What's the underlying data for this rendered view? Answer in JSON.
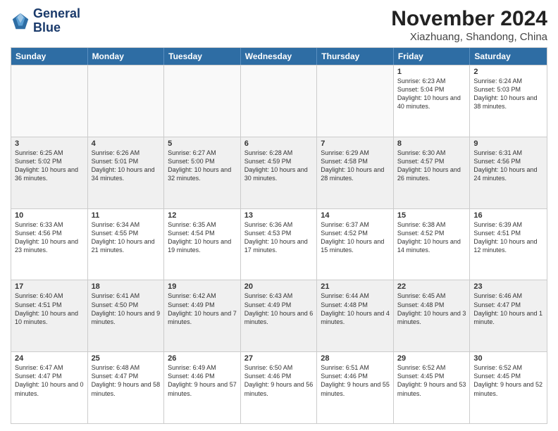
{
  "header": {
    "logo_line1": "General",
    "logo_line2": "Blue",
    "title": "November 2024",
    "subtitle": "Xiazhuang, Shandong, China"
  },
  "days": [
    "Sunday",
    "Monday",
    "Tuesday",
    "Wednesday",
    "Thursday",
    "Friday",
    "Saturday"
  ],
  "rows": [
    [
      {
        "day": "",
        "info": ""
      },
      {
        "day": "",
        "info": ""
      },
      {
        "day": "",
        "info": ""
      },
      {
        "day": "",
        "info": ""
      },
      {
        "day": "",
        "info": ""
      },
      {
        "day": "1",
        "info": "Sunrise: 6:23 AM\nSunset: 5:04 PM\nDaylight: 10 hours and 40 minutes."
      },
      {
        "day": "2",
        "info": "Sunrise: 6:24 AM\nSunset: 5:03 PM\nDaylight: 10 hours and 38 minutes."
      }
    ],
    [
      {
        "day": "3",
        "info": "Sunrise: 6:25 AM\nSunset: 5:02 PM\nDaylight: 10 hours and 36 minutes."
      },
      {
        "day": "4",
        "info": "Sunrise: 6:26 AM\nSunset: 5:01 PM\nDaylight: 10 hours and 34 minutes."
      },
      {
        "day": "5",
        "info": "Sunrise: 6:27 AM\nSunset: 5:00 PM\nDaylight: 10 hours and 32 minutes."
      },
      {
        "day": "6",
        "info": "Sunrise: 6:28 AM\nSunset: 4:59 PM\nDaylight: 10 hours and 30 minutes."
      },
      {
        "day": "7",
        "info": "Sunrise: 6:29 AM\nSunset: 4:58 PM\nDaylight: 10 hours and 28 minutes."
      },
      {
        "day": "8",
        "info": "Sunrise: 6:30 AM\nSunset: 4:57 PM\nDaylight: 10 hours and 26 minutes."
      },
      {
        "day": "9",
        "info": "Sunrise: 6:31 AM\nSunset: 4:56 PM\nDaylight: 10 hours and 24 minutes."
      }
    ],
    [
      {
        "day": "10",
        "info": "Sunrise: 6:33 AM\nSunset: 4:56 PM\nDaylight: 10 hours and 23 minutes."
      },
      {
        "day": "11",
        "info": "Sunrise: 6:34 AM\nSunset: 4:55 PM\nDaylight: 10 hours and 21 minutes."
      },
      {
        "day": "12",
        "info": "Sunrise: 6:35 AM\nSunset: 4:54 PM\nDaylight: 10 hours and 19 minutes."
      },
      {
        "day": "13",
        "info": "Sunrise: 6:36 AM\nSunset: 4:53 PM\nDaylight: 10 hours and 17 minutes."
      },
      {
        "day": "14",
        "info": "Sunrise: 6:37 AM\nSunset: 4:52 PM\nDaylight: 10 hours and 15 minutes."
      },
      {
        "day": "15",
        "info": "Sunrise: 6:38 AM\nSunset: 4:52 PM\nDaylight: 10 hours and 14 minutes."
      },
      {
        "day": "16",
        "info": "Sunrise: 6:39 AM\nSunset: 4:51 PM\nDaylight: 10 hours and 12 minutes."
      }
    ],
    [
      {
        "day": "17",
        "info": "Sunrise: 6:40 AM\nSunset: 4:51 PM\nDaylight: 10 hours and 10 minutes."
      },
      {
        "day": "18",
        "info": "Sunrise: 6:41 AM\nSunset: 4:50 PM\nDaylight: 10 hours and 9 minutes."
      },
      {
        "day": "19",
        "info": "Sunrise: 6:42 AM\nSunset: 4:49 PM\nDaylight: 10 hours and 7 minutes."
      },
      {
        "day": "20",
        "info": "Sunrise: 6:43 AM\nSunset: 4:49 PM\nDaylight: 10 hours and 6 minutes."
      },
      {
        "day": "21",
        "info": "Sunrise: 6:44 AM\nSunset: 4:48 PM\nDaylight: 10 hours and 4 minutes."
      },
      {
        "day": "22",
        "info": "Sunrise: 6:45 AM\nSunset: 4:48 PM\nDaylight: 10 hours and 3 minutes."
      },
      {
        "day": "23",
        "info": "Sunrise: 6:46 AM\nSunset: 4:47 PM\nDaylight: 10 hours and 1 minute."
      }
    ],
    [
      {
        "day": "24",
        "info": "Sunrise: 6:47 AM\nSunset: 4:47 PM\nDaylight: 10 hours and 0 minutes."
      },
      {
        "day": "25",
        "info": "Sunrise: 6:48 AM\nSunset: 4:47 PM\nDaylight: 9 hours and 58 minutes."
      },
      {
        "day": "26",
        "info": "Sunrise: 6:49 AM\nSunset: 4:46 PM\nDaylight: 9 hours and 57 minutes."
      },
      {
        "day": "27",
        "info": "Sunrise: 6:50 AM\nSunset: 4:46 PM\nDaylight: 9 hours and 56 minutes."
      },
      {
        "day": "28",
        "info": "Sunrise: 6:51 AM\nSunset: 4:46 PM\nDaylight: 9 hours and 55 minutes."
      },
      {
        "day": "29",
        "info": "Sunrise: 6:52 AM\nSunset: 4:45 PM\nDaylight: 9 hours and 53 minutes."
      },
      {
        "day": "30",
        "info": "Sunrise: 6:52 AM\nSunset: 4:45 PM\nDaylight: 9 hours and 52 minutes."
      }
    ]
  ]
}
